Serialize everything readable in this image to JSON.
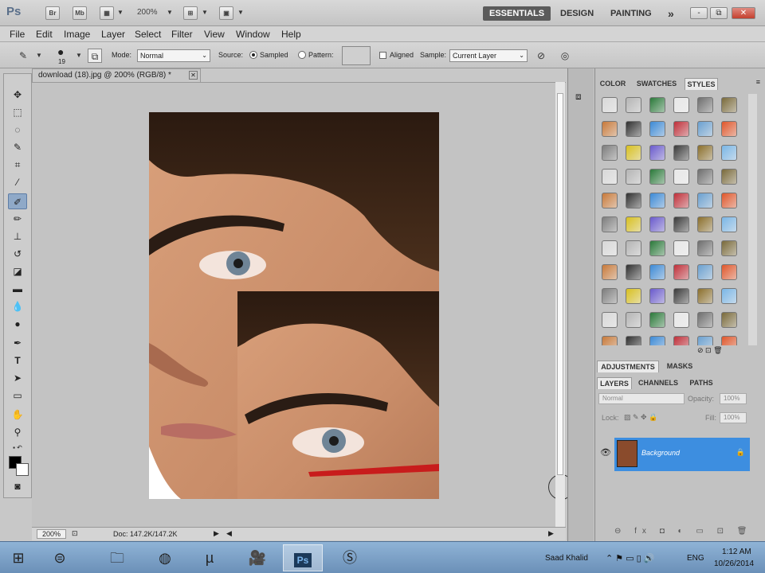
{
  "app": {
    "logo": "Ps",
    "bridge_label": "Br",
    "minibridge_label": "Mb",
    "zoom_level": "200%",
    "workspaces": [
      "ESSENTIALS",
      "DESIGN",
      "PAINTING"
    ],
    "more_workspaces": "»",
    "window_controls": {
      "minimize": "-",
      "restore": "⧉",
      "close": "✕"
    }
  },
  "menus": [
    "File",
    "Edit",
    "Image",
    "Layer",
    "Select",
    "Filter",
    "View",
    "Window",
    "Help"
  ],
  "options": {
    "brush_size": "19",
    "mode_label": "Mode:",
    "mode_value": "Normal",
    "source_label": "Source:",
    "sampled_label": "Sampled",
    "pattern_label": "Pattern:",
    "aligned_label": "Aligned",
    "sample_label": "Sample:",
    "sample_value": "Current Layer"
  },
  "document": {
    "tab_title": "download (18).jpg @ 200% (RGB/8) *",
    "zoom_field": "200%",
    "doc_size": "Doc: 147.2K/147.2K"
  },
  "panels": {
    "top_tabs": [
      "COLOR",
      "SWATCHES",
      "STYLES"
    ],
    "active_top_tab": "STYLES",
    "mid_tabs": [
      "ADJUSTMENTS",
      "MASKS"
    ],
    "layer_tabs": [
      "LAYERS",
      "CHANNELS",
      "PATHS"
    ],
    "blend_mode": "Normal",
    "opacity_label": "Opacity:",
    "opacity_value": "100%",
    "lock_label": "Lock:",
    "fill_label": "Fill:",
    "fill_value": "100%",
    "layers": [
      {
        "name": "Background",
        "visible": true,
        "locked": true
      }
    ]
  },
  "taskbar": {
    "user": "Saad Khalid",
    "language": "ENG",
    "time": "1:12 AM",
    "date": "10/26/2014"
  },
  "colors": {
    "active_layer": "#3d8ee0",
    "workspace_active": "#5b5b5b",
    "red_stroke": "#c81c1c"
  }
}
